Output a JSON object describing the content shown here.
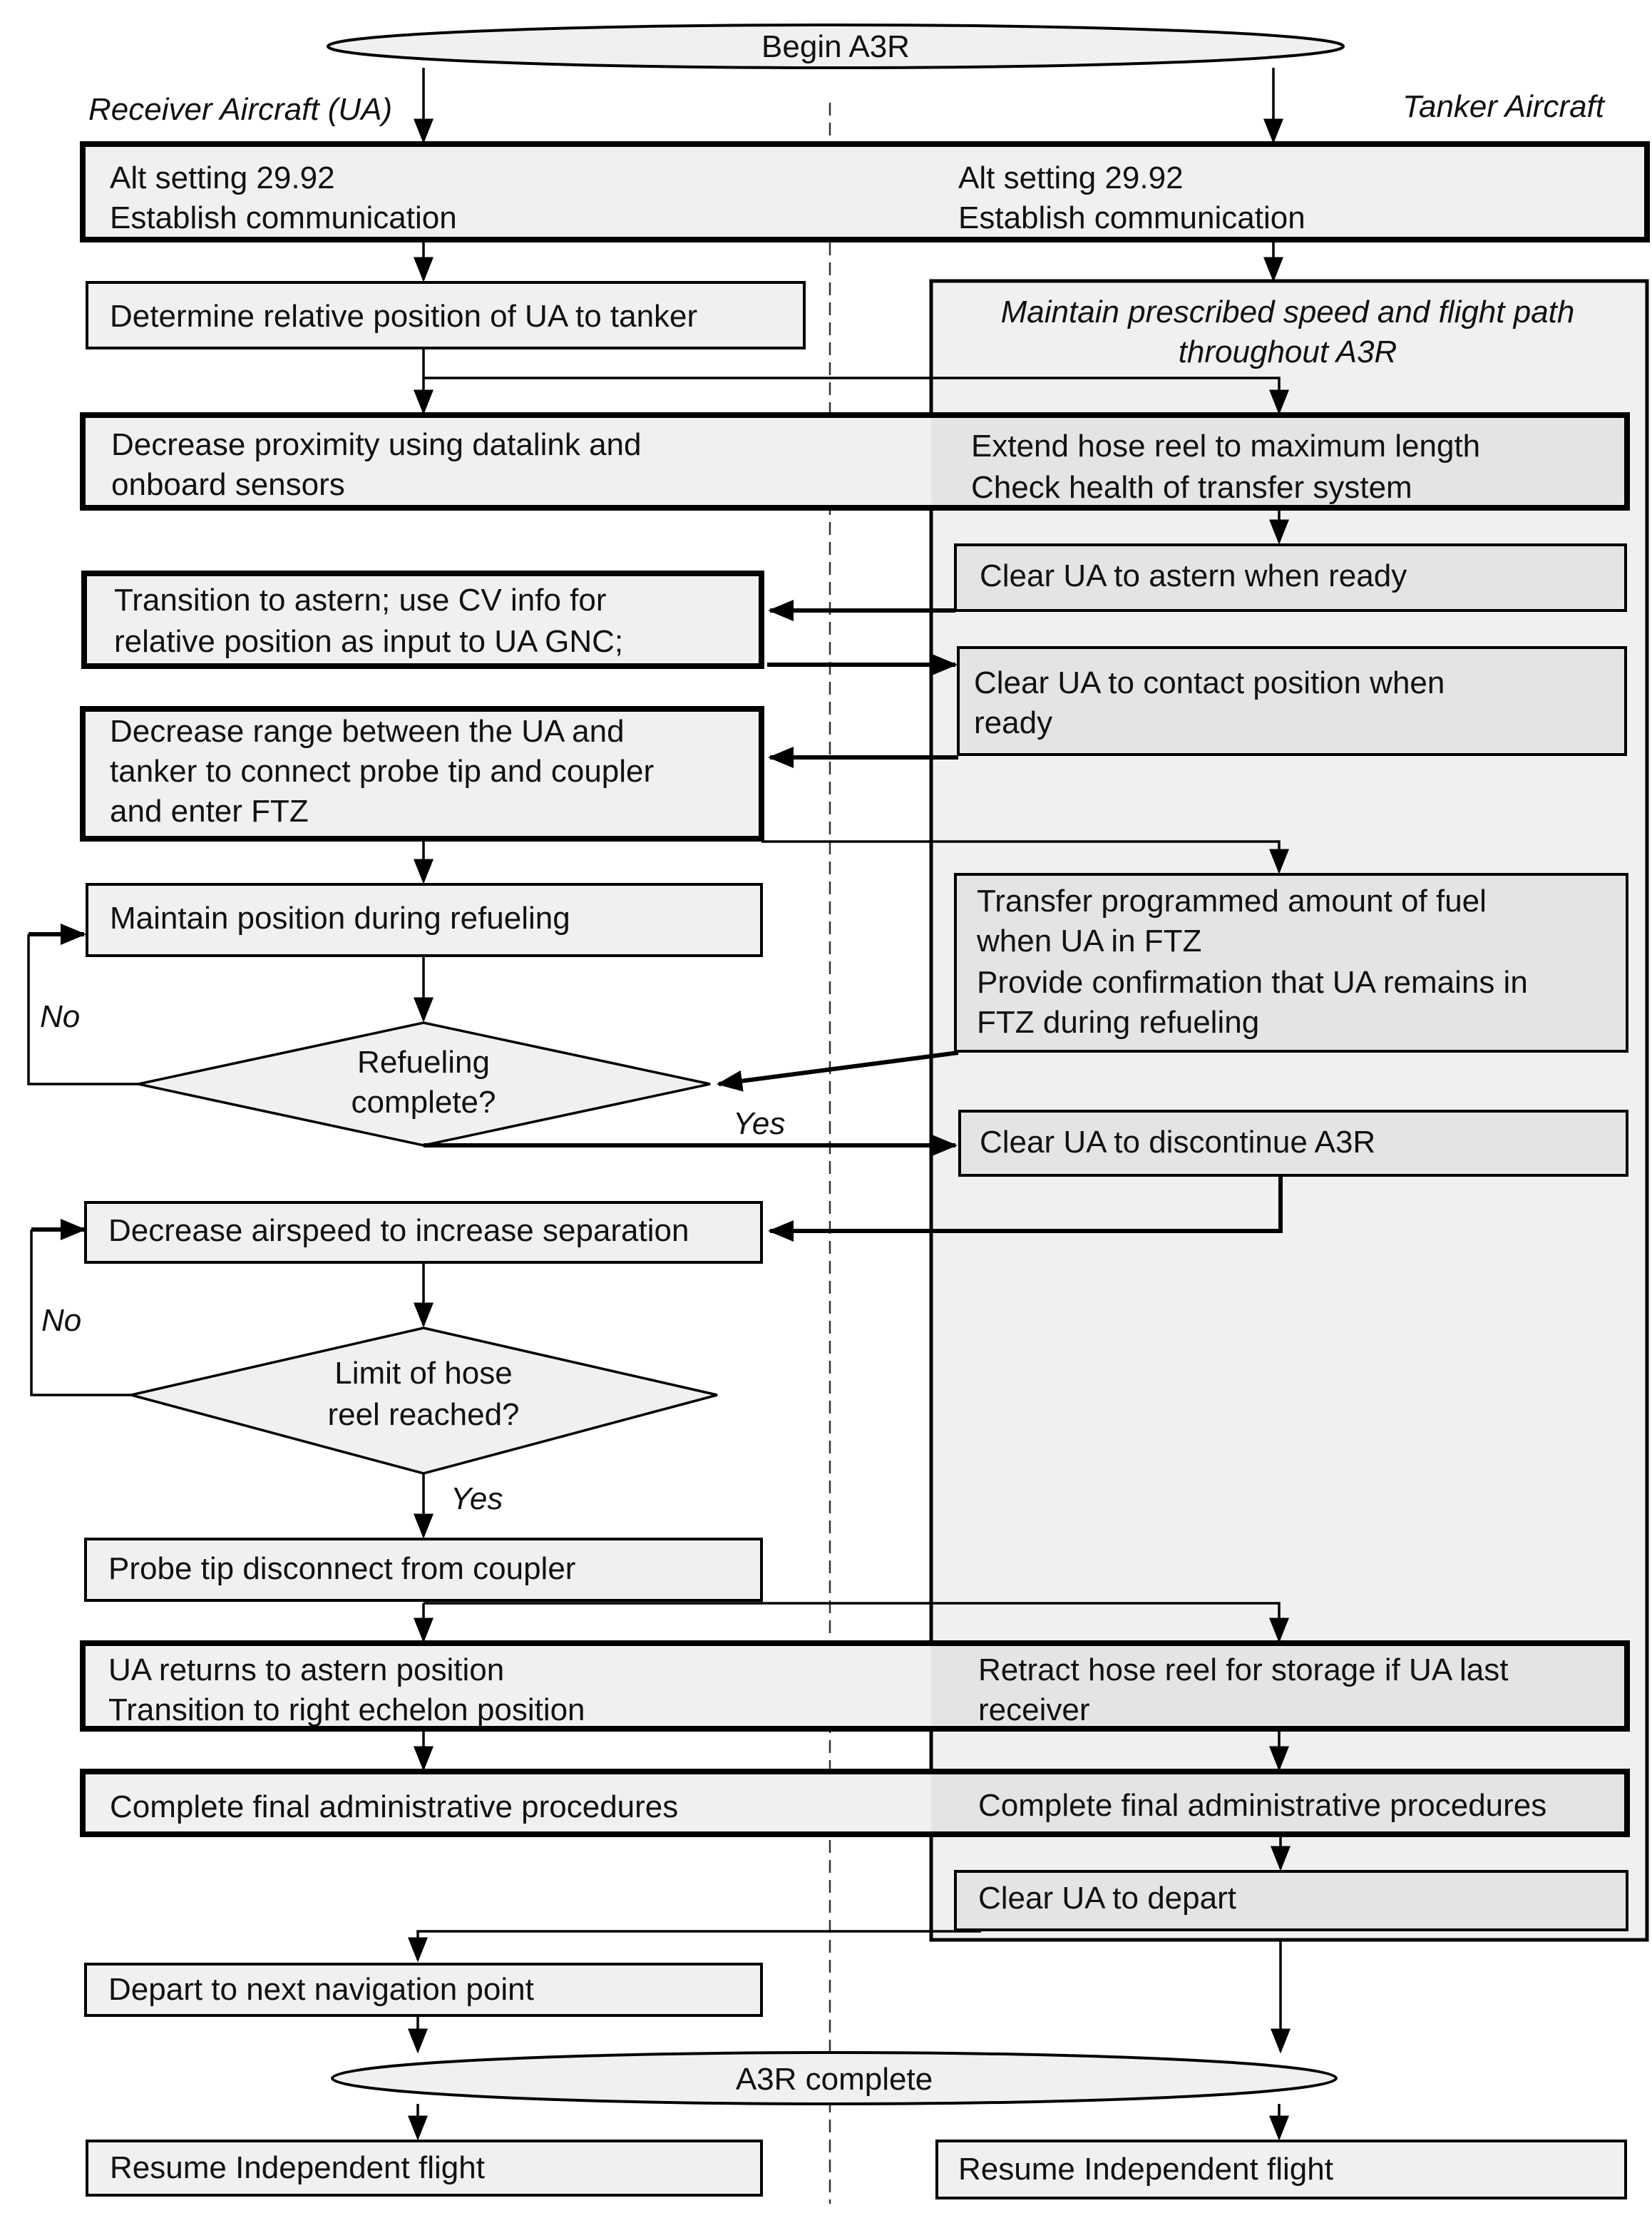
{
  "start": {
    "label": "Begin A3R"
  },
  "end": {
    "label": "A3R complete"
  },
  "lanes": {
    "receiver": "Receiver Aircraft (UA)",
    "tanker": "Tanker Aircraft"
  },
  "tanker_container": {
    "title_line1": "Maintain prescribed speed and flight path",
    "title_line2": "throughout A3R"
  },
  "shared_rows": {
    "setup": {
      "left": [
        "Alt setting 29.92",
        "Establish communication"
      ],
      "right": [
        "Alt setting 29.92",
        "Establish communication"
      ]
    },
    "approach": {
      "left": [
        "Decrease proximity using datalink and",
        "onboard sensors"
      ],
      "right": [
        "Extend hose reel to maximum length",
        "Check health of transfer system"
      ]
    },
    "return": {
      "left": [
        "UA returns to astern position",
        "Transition to right echelon position"
      ],
      "right": [
        "Retract hose reel for storage if UA last",
        "receiver"
      ]
    },
    "admin": {
      "left": [
        "Complete final administrative procedures"
      ],
      "right": [
        "Complete final administrative procedures"
      ]
    }
  },
  "receiver_steps": {
    "determine": "Determine relative position of UA to tanker",
    "transition": [
      "Transition to astern; use CV info for",
      "relative position as input to UA GNC;"
    ],
    "decrease_range": [
      "Decrease range between the UA and",
      "tanker to connect probe tip and coupler",
      "and enter FTZ"
    ],
    "maintain": "Maintain position during refueling",
    "decrease_airspeed": "Decrease airspeed to increase separation",
    "disconnect": "Probe tip disconnect from coupler",
    "depart": "Depart to next navigation point",
    "resume": "Resume Independent flight"
  },
  "tanker_steps": {
    "clear_astern": "Clear UA to astern when ready",
    "clear_contact": [
      "Clear UA to contact position when",
      "ready"
    ],
    "transfer": [
      "Transfer programmed amount of fuel",
      "when UA in FTZ",
      "Provide confirmation that UA remains in",
      "FTZ during refueling"
    ],
    "clear_discontinue": "Clear UA to discontinue A3R",
    "clear_depart": "Clear UA to depart",
    "resume": "Resume Independent flight"
  },
  "decisions": {
    "refueling": {
      "line1": "Refueling",
      "line2": "complete?",
      "yes": "Yes",
      "no": "No"
    },
    "hose_limit": {
      "line1": "Limit of hose",
      "line2": "reel reached?",
      "yes": "Yes",
      "no": "No"
    }
  },
  "colors": {
    "box_fill": "#f0f0f0",
    "tanker_action_fill": "#e4e4e4",
    "stroke": "#000000"
  }
}
